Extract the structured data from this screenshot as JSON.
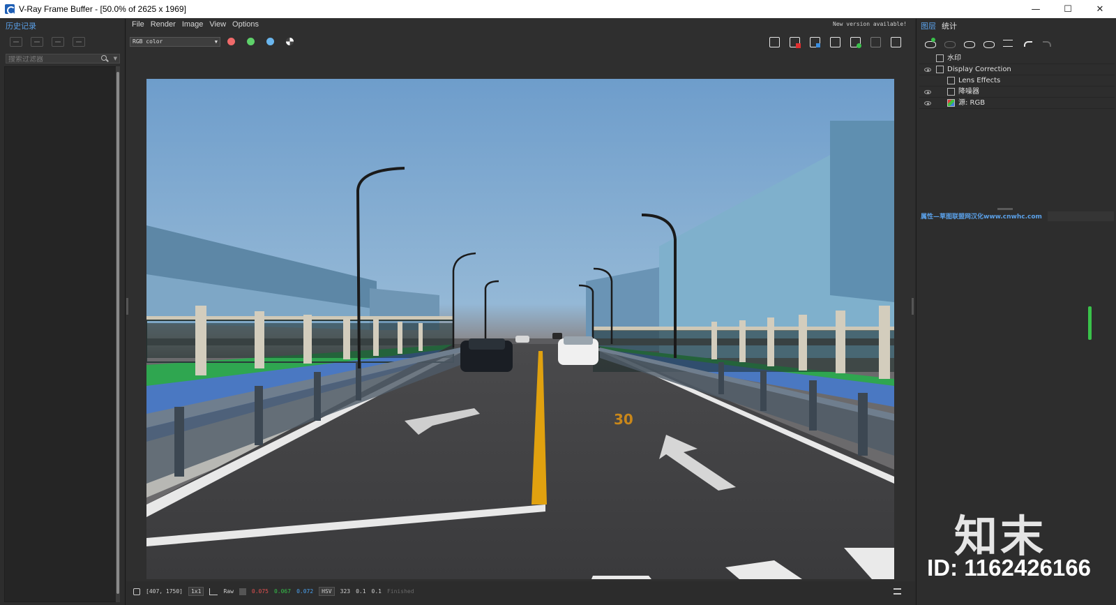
{
  "window": {
    "title": "V-Ray Frame Buffer - [50.0% of 2625 x 1969]",
    "minimize": "—",
    "maximize": "☐",
    "close": "✕"
  },
  "left_panel": {
    "tab": "历史记录",
    "search_placeholder": "搜索过滤器",
    "icons": [
      "history-save-icon",
      "history-compare-icon",
      "history-load-icon",
      "history-remove-icon"
    ]
  },
  "menu": {
    "items": [
      "File",
      "Render",
      "Image",
      "View",
      "Options"
    ],
    "new_version": "New version available!"
  },
  "toolbar": {
    "channel": "RGB color",
    "channel_dots": [
      {
        "name": "red-channel",
        "color": "#f06a6a"
      },
      {
        "name": "green-channel",
        "color": "#5ed16a"
      },
      {
        "name": "blue-channel",
        "color": "#6ab6ee"
      }
    ],
    "right_icons": [
      "save-image-icon",
      "clear-image-icon",
      "region-render-icon",
      "track-mouse-icon",
      "render-interactive-icon",
      "stop-render-icon",
      "render-icon"
    ]
  },
  "status": {
    "coords": "[407, 1750]",
    "zoom": "1x1",
    "mode": "Raw",
    "r": "0.075",
    "g": "0.067",
    "b": "0.072",
    "color_space": "HSV",
    "h": "323",
    "s": "0.1",
    "v": "0.1",
    "state": "Finished"
  },
  "right_panel": {
    "tabs": [
      "图层",
      "统计"
    ],
    "layers": [
      {
        "label": "水印",
        "eye": false,
        "indent": 1,
        "icon": "plain"
      },
      {
        "label": "Display Correction",
        "eye": true,
        "indent": 1,
        "icon": "plain"
      },
      {
        "label": "Lens Effects",
        "eye": false,
        "indent": 2,
        "icon": "plain"
      },
      {
        "label": "降噪器",
        "eye": true,
        "indent": 2,
        "icon": "plain"
      },
      {
        "label": "源: RGB",
        "eye": true,
        "indent": 2,
        "icon": "rgb"
      }
    ],
    "properties_label": "属性—草图联盟网汉化www.cnwhc.com"
  },
  "render": {
    "road_marking": "30"
  },
  "watermark": {
    "logo": "知末",
    "id": "ID: 1162426166"
  }
}
